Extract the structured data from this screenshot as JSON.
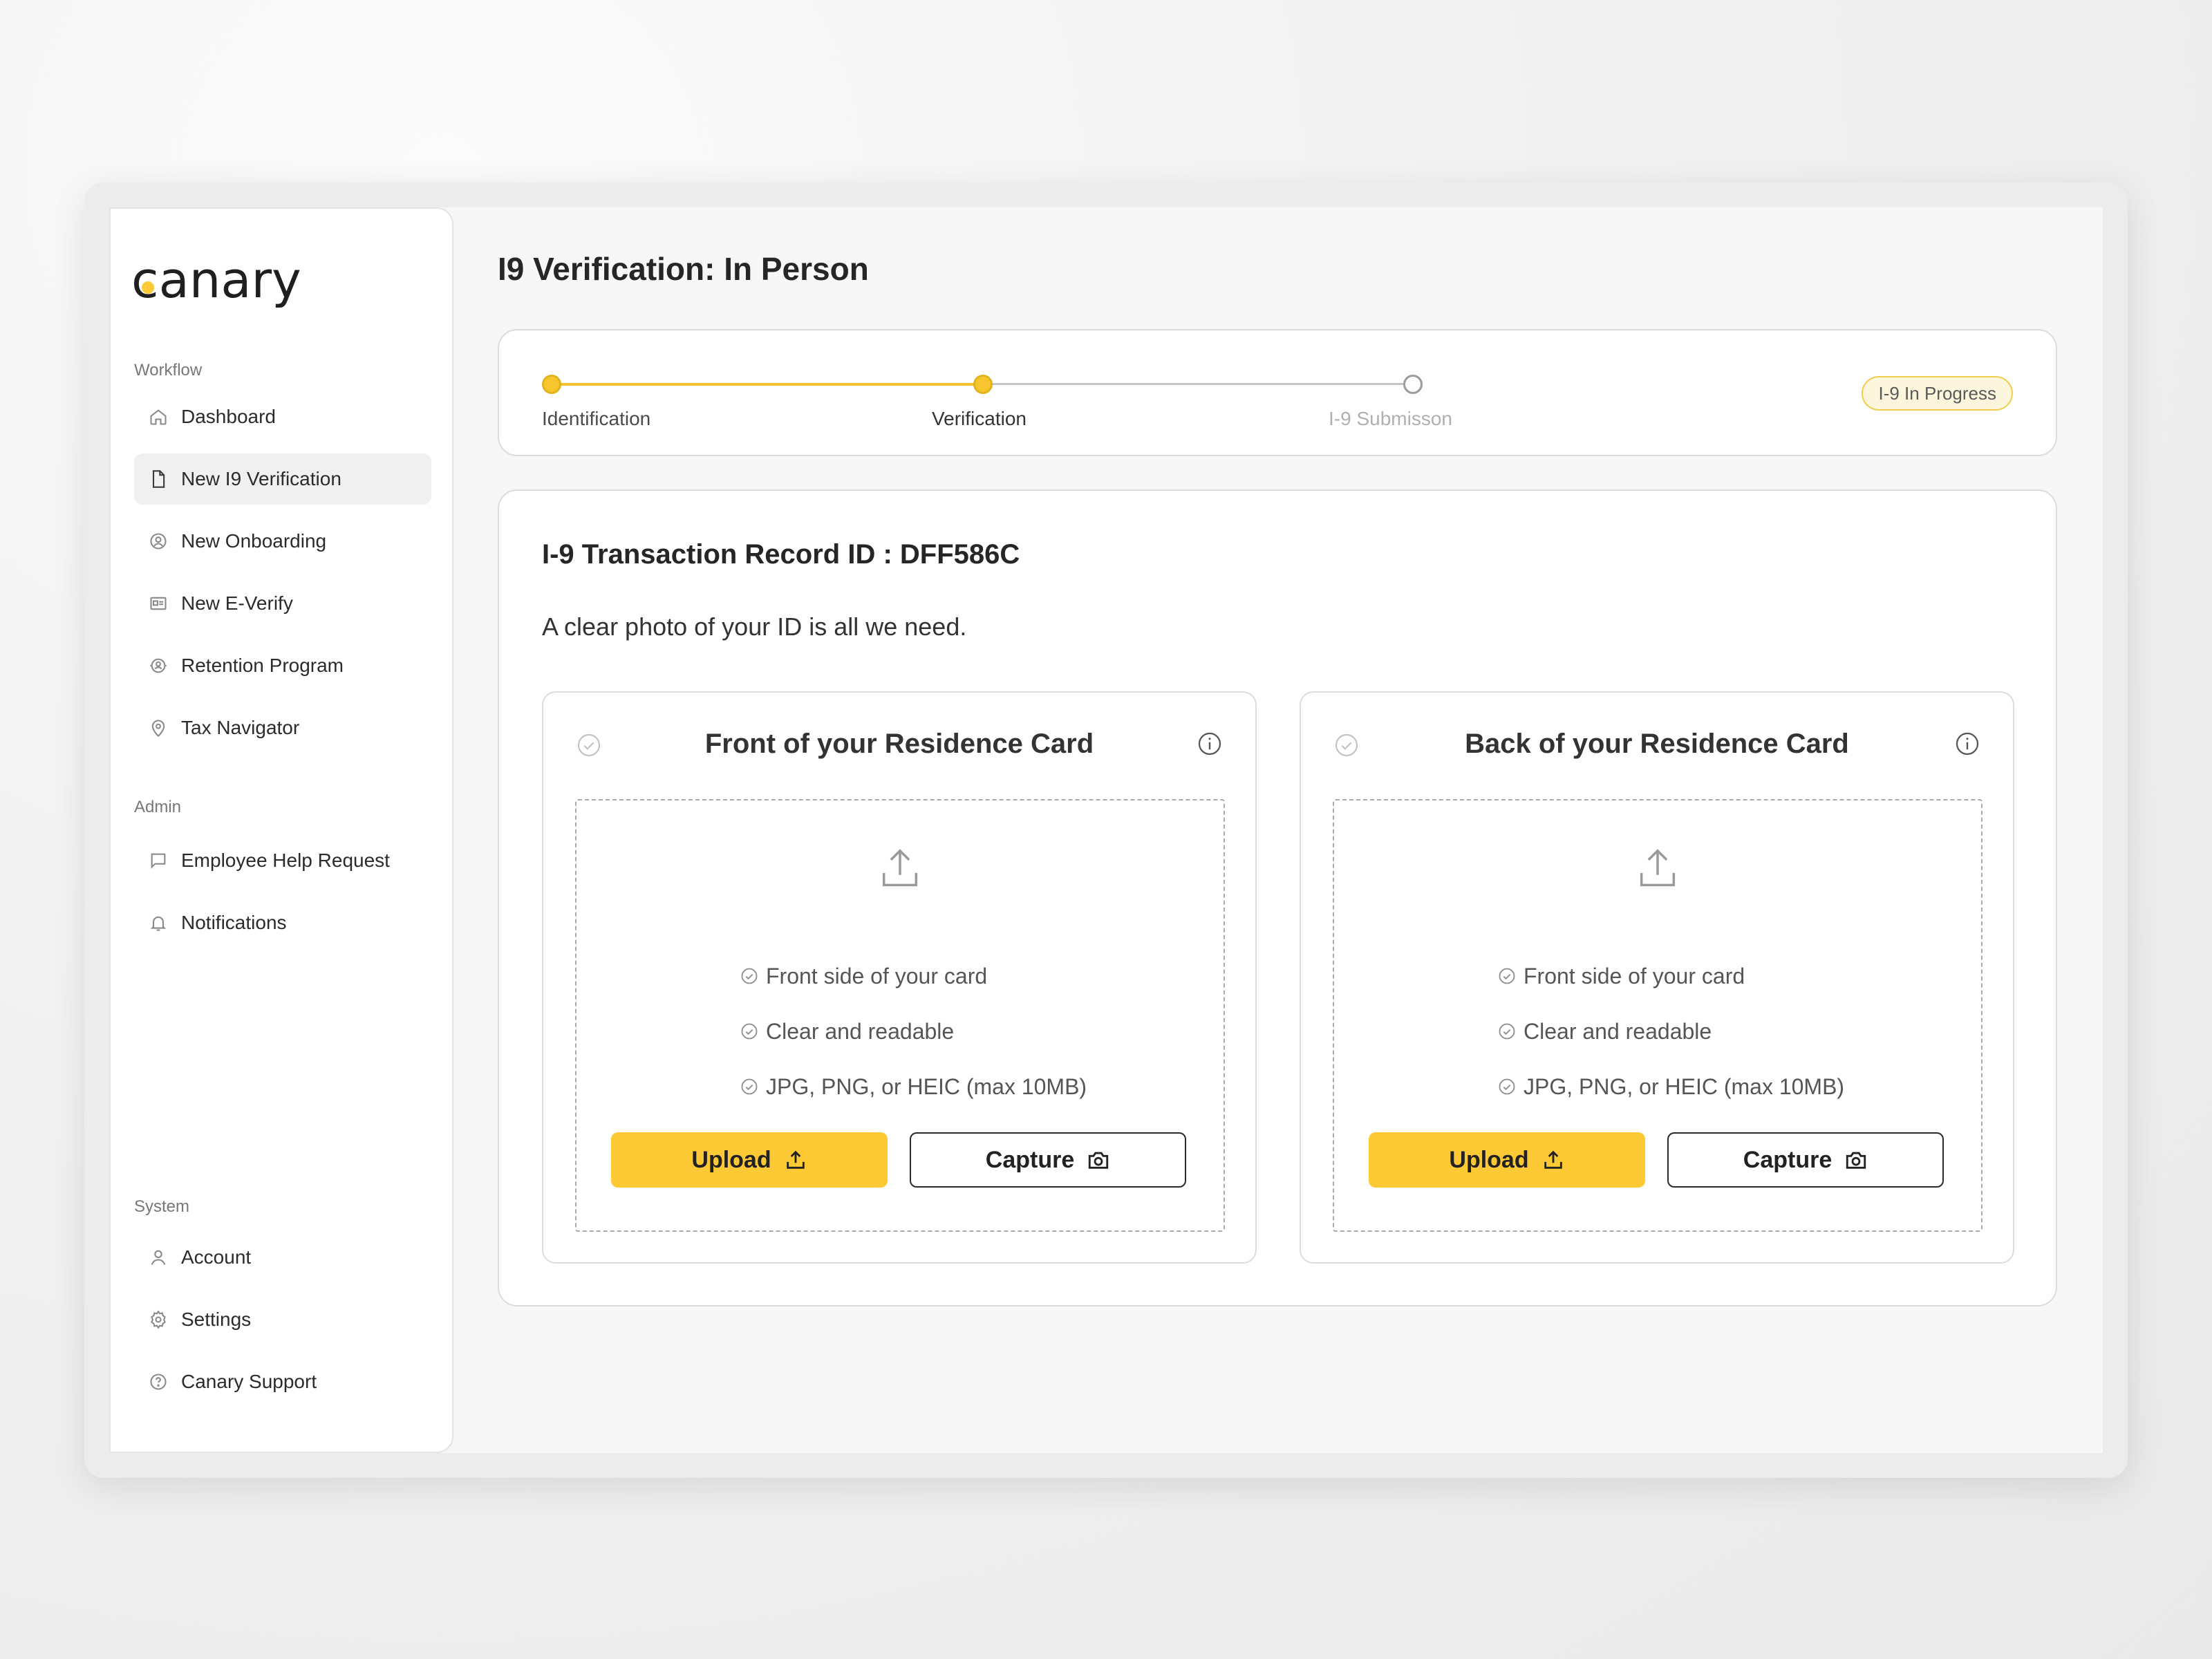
{
  "sidebar": {
    "logo": "canary",
    "workflow_label": "Workflow",
    "admin_label": "Admin",
    "system_label": "System",
    "workflow_items": [
      {
        "label": "Dashboard",
        "icon": "home-icon"
      },
      {
        "label": "New I9 Verification",
        "icon": "document-icon",
        "active": true
      },
      {
        "label": "New Onboarding",
        "icon": "onboarding-icon"
      },
      {
        "label": "New E-Verify",
        "icon": "id-card-icon"
      },
      {
        "label": "Retention Program",
        "icon": "retention-icon"
      },
      {
        "label": "Tax Navigator",
        "icon": "location-pin-icon"
      }
    ],
    "admin_items": [
      {
        "label": "Employee Help Request",
        "icon": "chat-icon"
      },
      {
        "label": "Notifications",
        "icon": "bell-icon"
      }
    ],
    "system_items": [
      {
        "label": "Account",
        "icon": "user-icon"
      },
      {
        "label": "Settings",
        "icon": "gear-icon"
      },
      {
        "label": "Canary Support",
        "icon": "help-circle-icon"
      }
    ]
  },
  "header": {
    "title": "I9 Verification: In Person"
  },
  "stepper": {
    "steps": [
      {
        "label": "Identification",
        "state": "complete"
      },
      {
        "label": "Verification",
        "state": "current"
      },
      {
        "label": "I-9 Submisson",
        "state": "pending"
      }
    ],
    "status_badge": "I-9 In Progress"
  },
  "record": {
    "title": "I-9 Transaction Record ID : DFF586C",
    "subtitle": "A clear photo of your ID is all we need."
  },
  "cards": [
    {
      "title": "Front of your Residence Card",
      "requirements": [
        "Front side of your card",
        "Clear and readable",
        "JPG, PNG, or HEIC (max 10MB)"
      ],
      "upload_label": "Upload",
      "capture_label": "Capture"
    },
    {
      "title": "Back of your Residence Card",
      "requirements": [
        "Front side of your card",
        "Clear and readable",
        "JPG, PNG, or HEIC (max 10MB)"
      ],
      "upload_label": "Upload",
      "capture_label": "Capture"
    }
  ],
  "colors": {
    "accent": "#fdca35",
    "accent_border": "#f0cd4c",
    "text_dark": "#262626",
    "muted": "#8a8a8a"
  }
}
